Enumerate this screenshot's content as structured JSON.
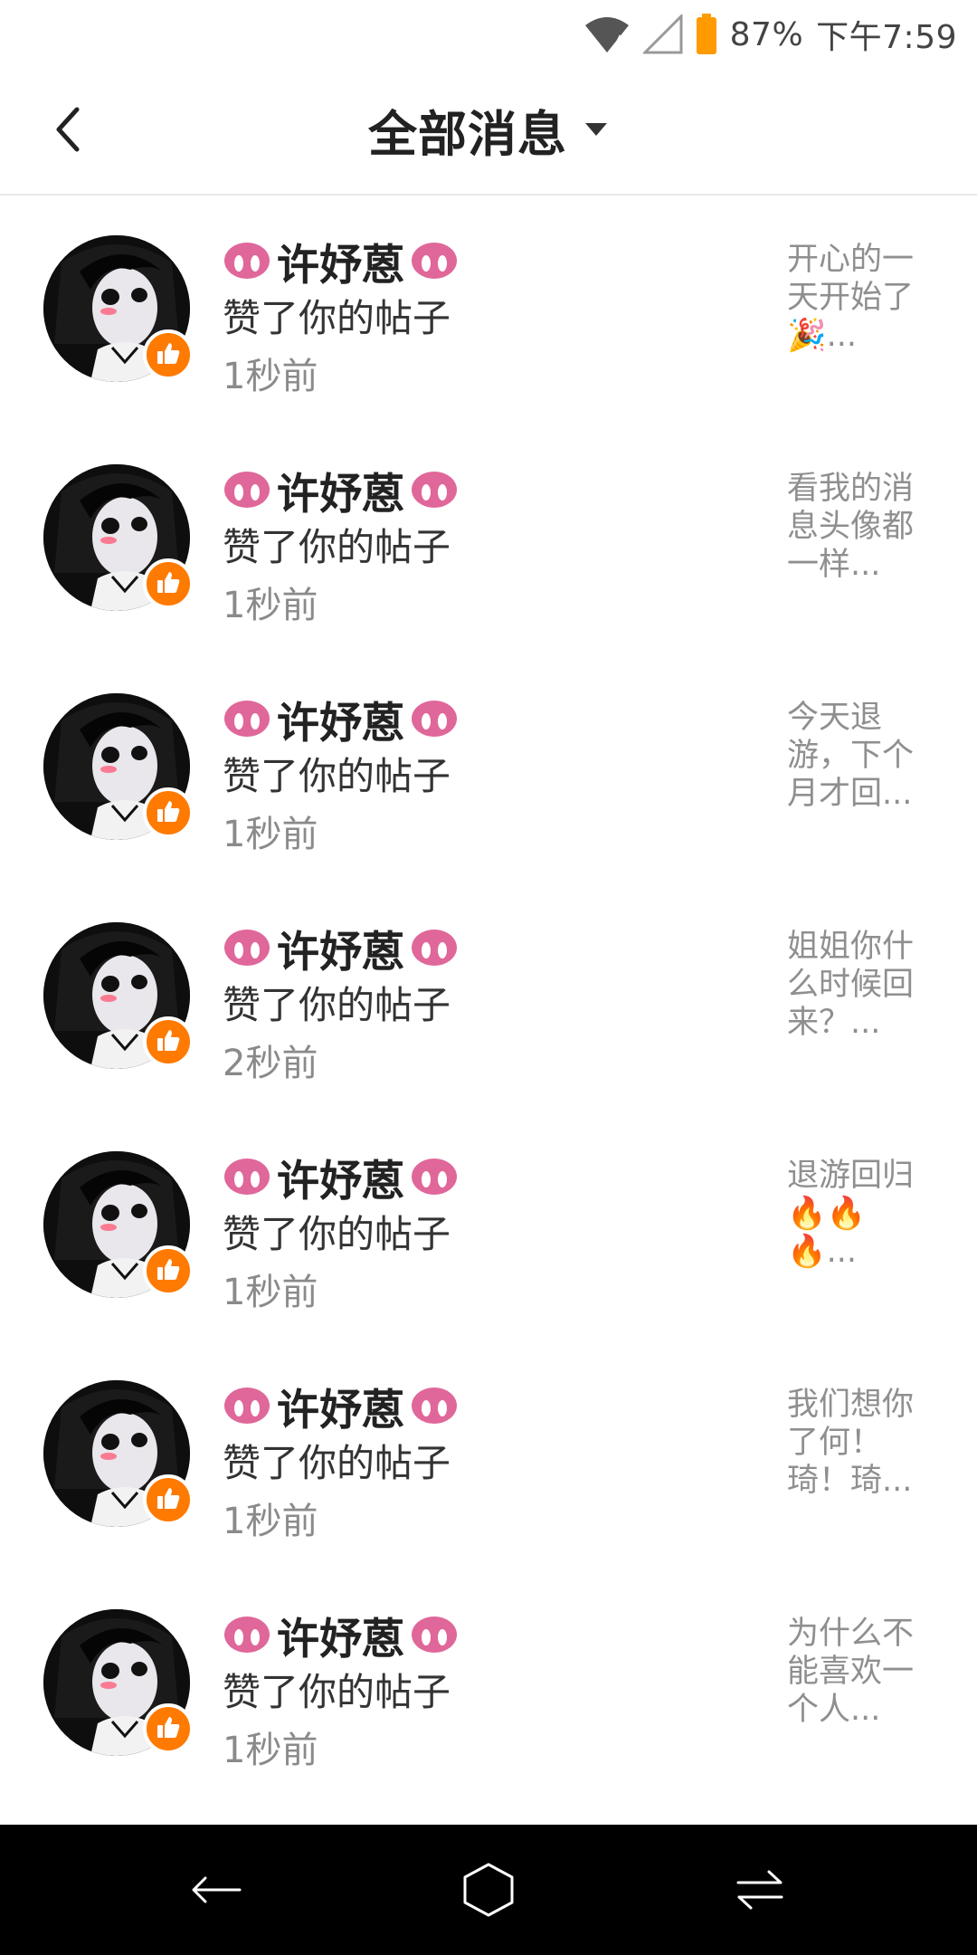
{
  "status_bar": {
    "battery_percent": "87%",
    "time": "下午7:59",
    "icons": [
      "wifi-icon",
      "signal-icon",
      "battery-icon"
    ],
    "battery_color": "#ff9a00"
  },
  "header": {
    "title": "全部消息",
    "back_icon": "chevron-left-icon",
    "dropdown_icon": "caret-down-icon"
  },
  "colors": {
    "badge": "#ff7a00",
    "pig_emoji": "#e0679a",
    "nav_bar": "#000000"
  },
  "notifications": [
    {
      "name": "许妤蒽",
      "action": "赞了你的帖子",
      "time": "1秒前",
      "preview": "开心的一天开始了🎉..."
    },
    {
      "name": "许妤蒽",
      "action": "赞了你的帖子",
      "time": "1秒前",
      "preview": "看我的消息头像都一样..."
    },
    {
      "name": "许妤蒽",
      "action": "赞了你的帖子",
      "time": "1秒前",
      "preview": "今天退游，下个月才回..."
    },
    {
      "name": "许妤蒽",
      "action": "赞了你的帖子",
      "time": "2秒前",
      "preview": "姐姐你什么时候回来？..."
    },
    {
      "name": "许妤蒽",
      "action": "赞了你的帖子",
      "time": "1秒前",
      "preview": "退游回归🔥🔥🔥..."
    },
    {
      "name": "许妤蒽",
      "action": "赞了你的帖子",
      "time": "1秒前",
      "preview": "我们想你了何！琦！琦..."
    },
    {
      "name": "许妤蒽",
      "action": "赞了你的帖子",
      "time": "1秒前",
      "preview": "为什么不能喜欢一个人..."
    }
  ],
  "nav_bar": {
    "buttons": [
      "back-arrow-icon",
      "home-icon",
      "recents-switch-icon"
    ]
  }
}
